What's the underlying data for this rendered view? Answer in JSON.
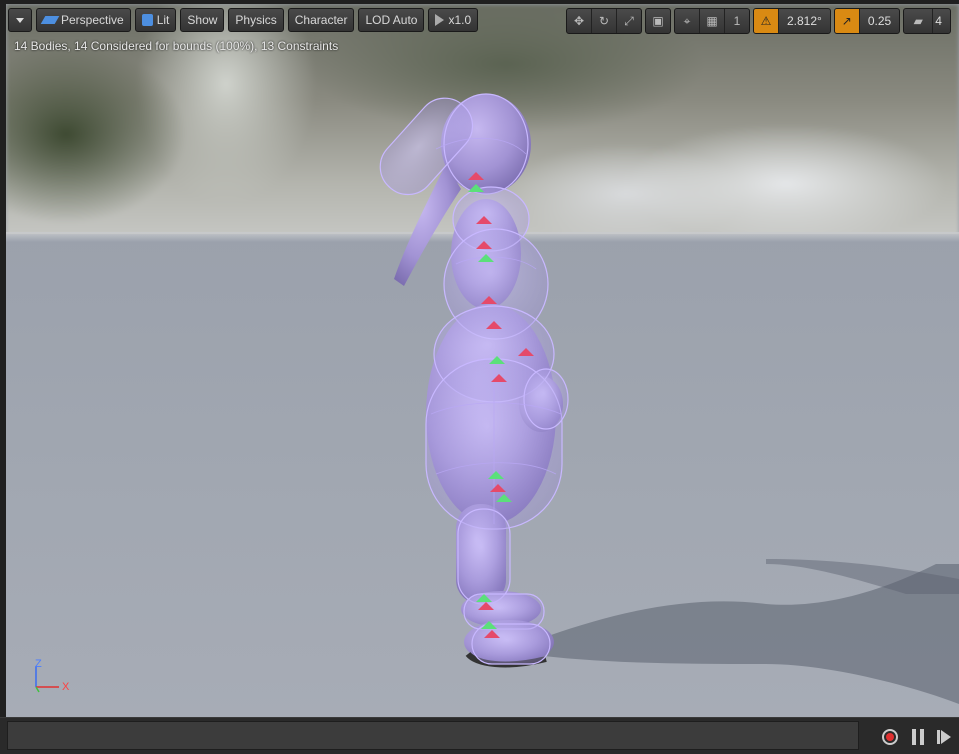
{
  "toolbar": {
    "menu_icon": "chevron-down-icon",
    "perspective_label": "Perspective",
    "lit_label": "Lit",
    "show_label": "Show",
    "physics_label": "Physics",
    "character_label": "Character",
    "lod_label": "LOD Auto",
    "playspeed_label": "x1.0",
    "grid_value": "1",
    "rotation_snap_value": "2.812°",
    "scale_snap_value": "0.25",
    "camera_speed_value": "4"
  },
  "stats": {
    "text": "14 Bodies, 14 Considered for bounds (100%), 13 Constraints"
  },
  "axis": {
    "z_label": "Z",
    "x_label": "X"
  },
  "colors": {
    "toolbar_accent": "#d98a13",
    "body_fill": "#a89ad6",
    "record_red": "#e03030"
  }
}
